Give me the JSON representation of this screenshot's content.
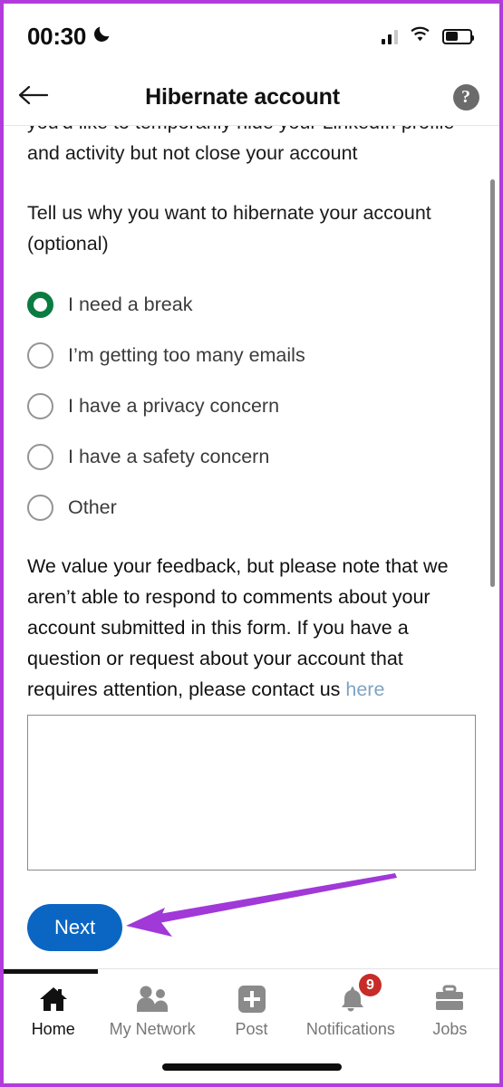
{
  "status_bar": {
    "time": "00:30",
    "moon_icon": "moon-icon",
    "signal_icon": "signal-bars-icon",
    "wifi_icon": "wifi-icon",
    "battery_icon": "battery-icon"
  },
  "header": {
    "back_icon": "back-arrow-icon",
    "title": "Hibernate account",
    "help_icon": "help-question-icon",
    "help_glyph": "?"
  },
  "main": {
    "intro_text": "you'd like to temporarily hide your LinkedIn profile and activity but not close your account",
    "question": "Tell us why you want to hibernate your account (optional)",
    "options": [
      {
        "label": "I need a break",
        "selected": true
      },
      {
        "label": "I’m getting too many emails",
        "selected": false
      },
      {
        "label": "I have a privacy concern",
        "selected": false
      },
      {
        "label": "I have a safety concern",
        "selected": false
      },
      {
        "label": "Other",
        "selected": false
      }
    ],
    "note_text": "We value your feedback, but please note that we aren’t able to respond to comments about your account submitted in this form. If you have a question or request about your account that requires attention, please contact us ",
    "note_link": "here",
    "feedback_value": "",
    "feedback_placeholder": "",
    "next_label": "Next"
  },
  "bottom_nav": {
    "items": [
      {
        "label": "Home",
        "icon": "home-icon",
        "active": true,
        "badge": ""
      },
      {
        "label": "My Network",
        "icon": "people-icon",
        "active": false,
        "badge": ""
      },
      {
        "label": "Post",
        "icon": "plus-square-icon",
        "active": false,
        "badge": ""
      },
      {
        "label": "Notifications",
        "icon": "bell-icon",
        "active": false,
        "badge": "9"
      },
      {
        "label": "Jobs",
        "icon": "briefcase-icon",
        "active": false,
        "badge": ""
      }
    ]
  },
  "annotation": {
    "arrow_icon": "pointer-arrow-annotation",
    "color": "#a039d8"
  },
  "colors": {
    "accent_blue": "#0a66c2",
    "selected_green": "#0a7c41",
    "badge_red": "#c72c28",
    "link_blue": "#7fa3c4",
    "frame_purple": "#b23cdb"
  }
}
